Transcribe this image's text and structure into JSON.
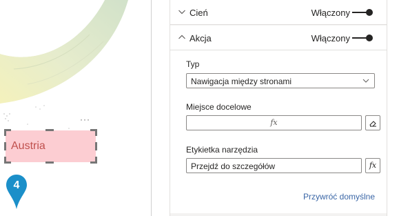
{
  "canvas": {
    "visual_label": "Austria",
    "more_glyph": "···",
    "pin_number": "4"
  },
  "format_pane": {
    "cards": [
      {
        "title": "Cień",
        "state": "Włączony",
        "expanded": false
      },
      {
        "title": "Akcja",
        "state": "Włączony",
        "expanded": true
      }
    ],
    "action": {
      "type_label": "Typ",
      "type_value": "Nawigacja między stronami",
      "destination_label": "Miejsce docelowe",
      "destination_fx": "fx",
      "tooltip_label": "Etykietka narzędzia",
      "tooltip_value": "Przejdź do szczegółów",
      "tooltip_fx": "fx",
      "reset_label": "Przywróć domyślne"
    }
  },
  "colors": {
    "accent_link": "#3a66a6",
    "selected_visual_fill": "#fccdd2",
    "selected_visual_text": "#c0504d",
    "pin": "#1b8fc9"
  },
  "icons": [
    "chevron-down-icon",
    "chevron-up-icon",
    "toggle-switch-icon",
    "dropdown-caret-icon",
    "eraser-icon",
    "fx-icon",
    "map-pin-icon",
    "more-options-icon"
  ]
}
